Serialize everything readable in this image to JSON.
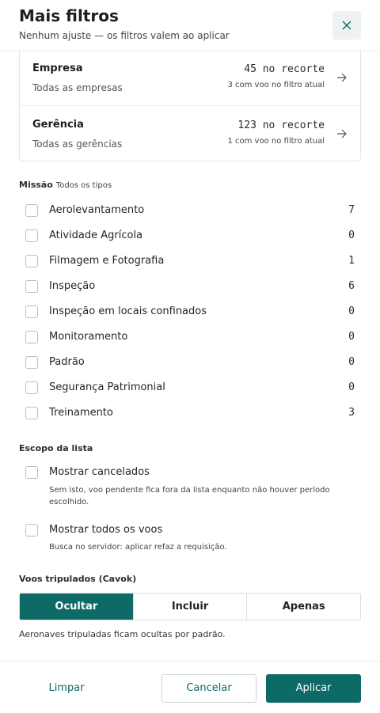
{
  "header": {
    "title": "Mais filtros",
    "subtitle": "Nenhum ajuste — os filtros valem ao aplicar"
  },
  "summary": [
    {
      "label": "Empresa",
      "value": "Todas as empresas",
      "count": "45 no recorte",
      "note": "3 com voo no filtro atual"
    },
    {
      "label": "Gerência",
      "value": "Todas as gerências",
      "count": "123 no recorte",
      "note": "1 com voo no filtro atual"
    }
  ],
  "missao": {
    "label": "Missão",
    "sub": "Todos os tipos",
    "items": [
      {
        "label": "Aerolevantamento",
        "count": "7"
      },
      {
        "label": "Atividade Agrícola",
        "count": "0"
      },
      {
        "label": "Filmagem e Fotografia",
        "count": "1"
      },
      {
        "label": "Inspeção",
        "count": "6"
      },
      {
        "label": "Inspeção em locais confinados",
        "count": "0"
      },
      {
        "label": "Monitoramento",
        "count": "0"
      },
      {
        "label": "Padrão",
        "count": "0"
      },
      {
        "label": "Segurança Patrimonial",
        "count": "0"
      },
      {
        "label": "Treinamento",
        "count": "3"
      }
    ]
  },
  "escopo": {
    "label": "Escopo da lista",
    "items": [
      {
        "label": "Mostrar cancelados",
        "help": "Sem isto, voo pendente fica fora da lista enquanto não houver período escolhido."
      },
      {
        "label": "Mostrar todos os voos",
        "help": "Busca no servidor: aplicar refaz a requisição."
      }
    ]
  },
  "tripulados": {
    "label": "Voos tripulados (Cavok)",
    "options": [
      "Ocultar",
      "Incluir",
      "Apenas"
    ],
    "selected": "Ocultar",
    "note": "Aeronaves tripuladas ficam ocultas por padrão."
  },
  "footer": {
    "clear": "Limpar",
    "cancel": "Cancelar",
    "apply": "Aplicar"
  },
  "colors": {
    "accent": "#0e6a66"
  },
  "icons": {
    "close": "close-icon",
    "arrow": "arrow-right-icon"
  }
}
